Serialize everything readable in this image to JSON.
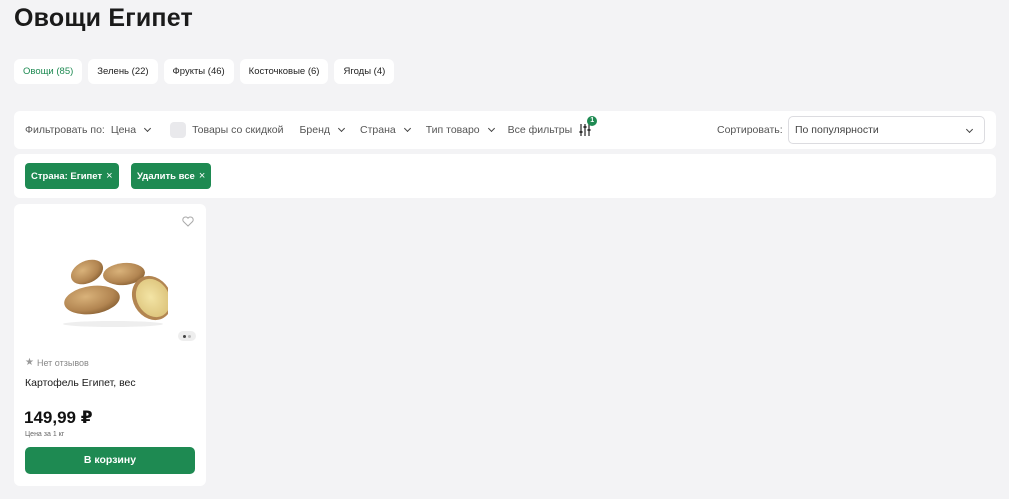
{
  "page": {
    "title": "Овощи Египет"
  },
  "tabs": [
    {
      "label": "Овощи (85)",
      "active": true
    },
    {
      "label": "Зелень (22)"
    },
    {
      "label": "Фрукты (46)"
    },
    {
      "label": "Косточковые (6)"
    },
    {
      "label": "Ягоды (4)"
    }
  ],
  "filters": {
    "label": "Фильтровать по:",
    "price": "Цена",
    "discount": "Товары со скидкой",
    "brand": "Бренд",
    "country": "Страна",
    "type": "Тип товаро",
    "all": "Все фильтры",
    "badge": "1",
    "sort_label": "Сортировать:",
    "sort_value": "По популярности"
  },
  "chips": [
    {
      "label": "Страна: Египет",
      "close": "×"
    },
    {
      "label": "Удалить все",
      "close": "×"
    }
  ],
  "product": {
    "rating": "Нет отзывов",
    "name": "Картофель Египет, вес",
    "price": "149,99 ₽",
    "unit": "Цена за 1 кг",
    "button": "В корзину"
  },
  "colors": {
    "accent": "#1e8a52",
    "background": "#f3f3f5"
  }
}
